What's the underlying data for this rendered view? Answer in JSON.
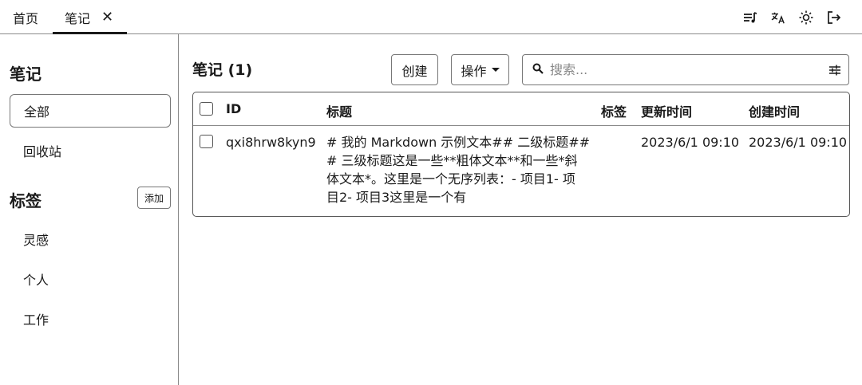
{
  "tabs": {
    "home": "首页",
    "notes": "笔记",
    "close": "✕"
  },
  "top_icons": [
    "list-music-icon",
    "translate-icon",
    "sun-icon",
    "logout-icon"
  ],
  "sidebar": {
    "notes_heading": "笔记",
    "items": [
      {
        "label": "全部"
      },
      {
        "label": "回收站"
      }
    ],
    "tags_heading": "标签",
    "add_label": "添加",
    "tags": [
      {
        "label": "灵感"
      },
      {
        "label": "个人"
      },
      {
        "label": "工作"
      }
    ]
  },
  "main": {
    "title": "笔记 (1)",
    "create_label": "创建",
    "ops_label": "操作",
    "search_placeholder": "搜索..."
  },
  "table": {
    "headers": {
      "id": "ID",
      "title": "标题",
      "tags": "标签",
      "updated": "更新时间",
      "created": "创建时间"
    },
    "rows": [
      {
        "id": "qxi8hrw8kyn9",
        "title_lines": [
          "# 我的 Markdown 示例文本## 二级标题##",
          "# 三级标题这是一些**粗体文本**和一些*斜",
          "体文本*。这里是一个无序列表：- 项目1- 项",
          "目2- 项目3这里是一个有"
        ],
        "tags": "",
        "updated": "2023/6/1 09:10",
        "created": "2023/6/1 09:10"
      }
    ]
  },
  "colors": {
    "border": "#777777",
    "text": "#1a1a1a"
  }
}
